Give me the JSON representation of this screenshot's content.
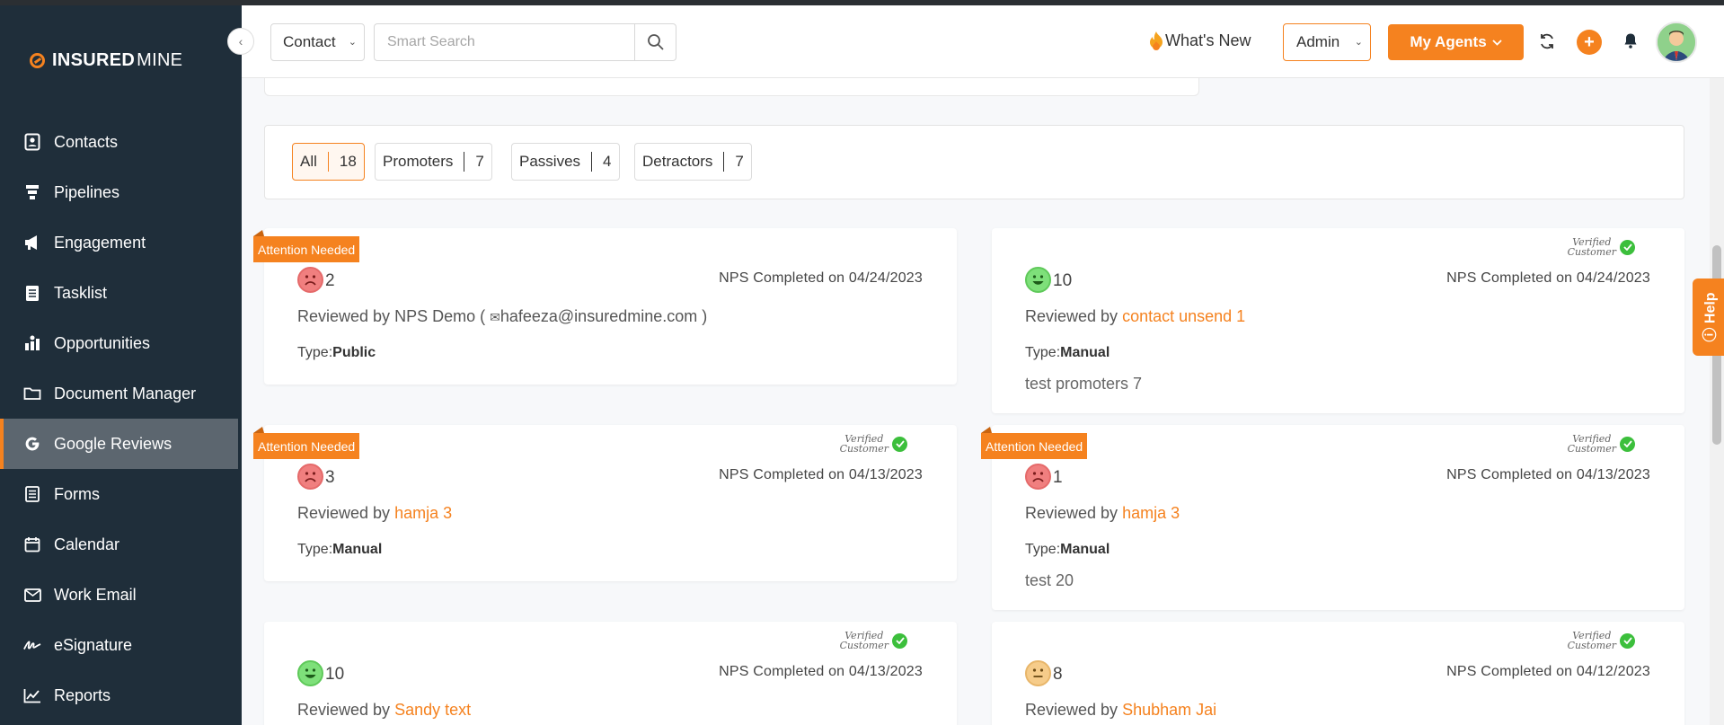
{
  "brand": {
    "name_bold": "INSURED",
    "name_light": "MINE"
  },
  "sidebar": {
    "items": [
      {
        "label": "Contacts",
        "icon": "contacts-icon"
      },
      {
        "label": "Pipelines",
        "icon": "funnel-icon"
      },
      {
        "label": "Engagement",
        "icon": "megaphone-icon"
      },
      {
        "label": "Tasklist",
        "icon": "list-icon"
      },
      {
        "label": "Opportunities",
        "icon": "opportunities-icon"
      },
      {
        "label": "Document Manager",
        "icon": "folder-icon"
      },
      {
        "label": "Google Reviews",
        "icon": "google-icon",
        "active": true
      },
      {
        "label": "Forms",
        "icon": "form-icon"
      },
      {
        "label": "Calendar",
        "icon": "calendar-icon"
      },
      {
        "label": "Work Email",
        "icon": "mail-icon"
      },
      {
        "label": "eSignature",
        "icon": "signature-icon"
      },
      {
        "label": "Reports",
        "icon": "chart-icon"
      }
    ]
  },
  "header": {
    "context_select": "Contact",
    "search_placeholder": "Smart Search",
    "whats_new": "What's New",
    "role_select": "Admin",
    "agents_button": "My Agents"
  },
  "filters": [
    {
      "label": "All",
      "count": "18",
      "active": true
    },
    {
      "label": "Promoters",
      "count": "7"
    },
    {
      "label": "Passives",
      "count": "4"
    },
    {
      "label": "Detractors",
      "count": "7"
    }
  ],
  "labels": {
    "attention": "Attention Needed",
    "verified_line1": "Verified",
    "verified_line2": "Customer",
    "reviewed_by": "Reviewed by",
    "type_prefix": "Type:",
    "help": "Help"
  },
  "reviews": [
    {
      "score": "2",
      "mood": "sad",
      "attention": true,
      "verified": false,
      "date": "NPS Completed on 04/24/2023",
      "reviewer": "NPS Demo (",
      "email": "hafeeza@insuredmine.com",
      "email_close": ")",
      "type": "Public",
      "comment": ""
    },
    {
      "score": "10",
      "mood": "happy",
      "attention": false,
      "verified": true,
      "date": "NPS Completed on 04/24/2023",
      "reviewer": "contact unsend 1",
      "type": "Manual",
      "comment": "test promoters 7"
    },
    {
      "score": "3",
      "mood": "sad",
      "attention": true,
      "verified": true,
      "date": "NPS Completed on 04/13/2023",
      "reviewer": "hamja 3",
      "type": "Manual",
      "comment": ""
    },
    {
      "score": "1",
      "mood": "sad",
      "attention": true,
      "verified": true,
      "date": "NPS Completed on 04/13/2023",
      "reviewer": "hamja 3",
      "type": "Manual",
      "comment": "test 20"
    },
    {
      "score": "10",
      "mood": "happy",
      "attention": false,
      "verified": true,
      "date": "NPS Completed on 04/13/2023",
      "reviewer": "Sandy text",
      "type": "",
      "comment": ""
    },
    {
      "score": "8",
      "mood": "neutral",
      "attention": false,
      "verified": true,
      "date": "NPS Completed on 04/12/2023",
      "reviewer": "Shubham Jai",
      "type": "",
      "comment": ""
    }
  ],
  "colors": {
    "accent": "#f5821f",
    "sidebar": "#1f2e3a",
    "active_item": "#5c666f"
  }
}
